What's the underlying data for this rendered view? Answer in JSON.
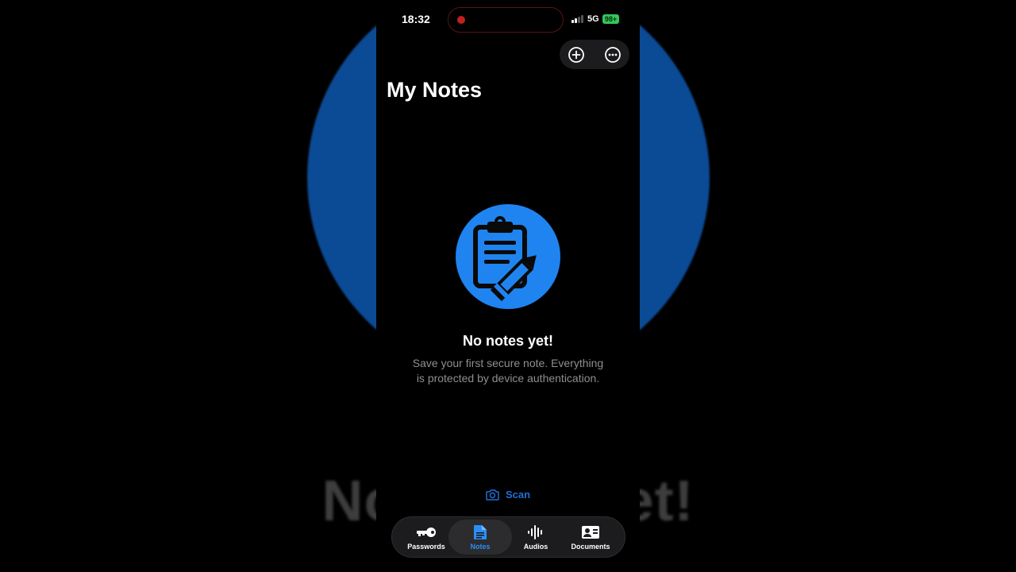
{
  "status_bar": {
    "time": "18:32",
    "network": "5G",
    "battery": "98+"
  },
  "header": {
    "title": "My Notes",
    "actions": [
      {
        "name": "add",
        "icon": "plus-circle-icon"
      },
      {
        "name": "more",
        "icon": "ellipsis-circle-icon"
      }
    ]
  },
  "empty_state": {
    "icon": "clipboard-pencil-icon",
    "title": "No notes yet!",
    "message": "Save your first secure note. Everything is protected by device authentication."
  },
  "scan": {
    "label": "Scan",
    "icon": "camera-icon"
  },
  "tabs": [
    {
      "label": "Passwords",
      "icon": "key-icon",
      "active": false
    },
    {
      "label": "Notes",
      "icon": "document-icon",
      "active": true
    },
    {
      "label": "Audios",
      "icon": "waveform-icon",
      "active": false
    },
    {
      "label": "Documents",
      "icon": "id-card-icon",
      "active": false
    }
  ],
  "colors": {
    "accent": "#1f84f0",
    "background": "#000000",
    "secondary_text": "#8e8e93",
    "battery": "#34c759",
    "tab_bar": "#1c1c1e"
  }
}
